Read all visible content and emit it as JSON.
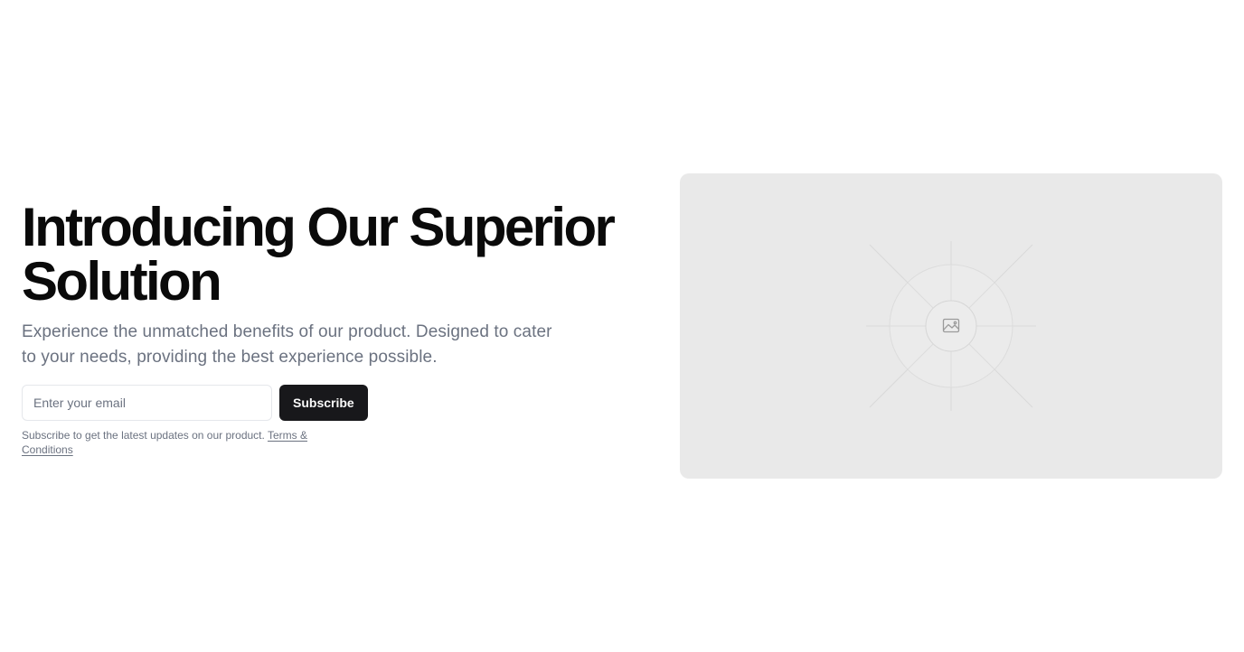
{
  "hero": {
    "headline_line1": "Introducing Our Superior",
    "headline_line2": "Solution",
    "subtitle": "Experience the unmatched benefits of our product. Designed to cater to your needs, providing the best experience possible.",
    "email_placeholder": "Enter your email",
    "email_value": "",
    "subscribe_label": "Subscribe",
    "fine_print": "Subscribe to get the latest updates on our product. ",
    "terms_link": "Terms & Conditions"
  },
  "media": {
    "icon": "image-icon",
    "background_color": "#e9e9e9"
  },
  "colors": {
    "headline": "#0a0a0a",
    "muted_text": "#6b7280",
    "button_bg": "#18181b",
    "button_text": "#fafafa"
  }
}
